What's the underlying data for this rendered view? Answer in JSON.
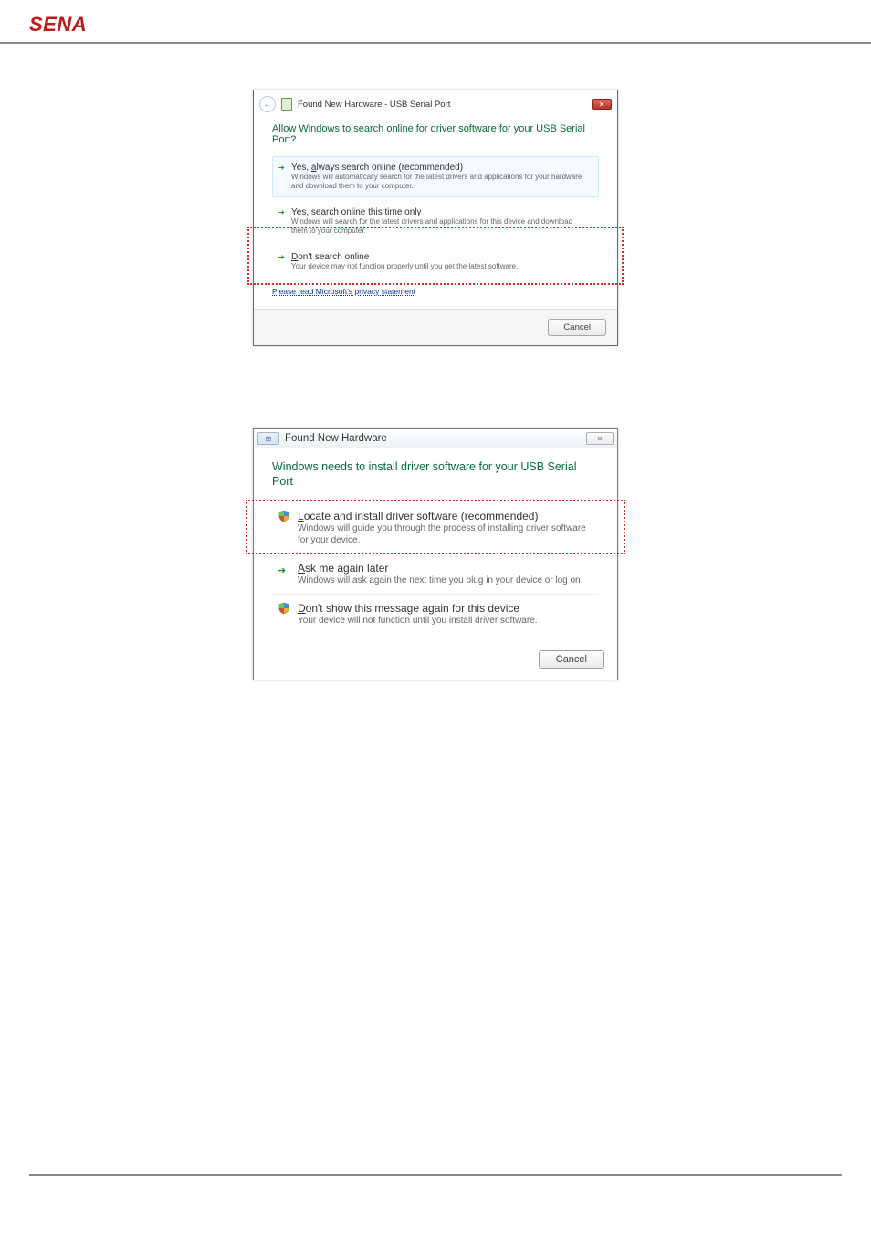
{
  "logo_text": "SENA",
  "dialog1": {
    "window_title": "Found New Hardware - USB Serial Port",
    "heading": "Allow Windows to search online for driver software for your USB Serial Port?",
    "options": [
      {
        "title_pre": "Yes, ",
        "title_ul_char": "a",
        "title_rest": "lways search online (recommended)",
        "desc": "Windows will automatically search for the latest drivers and applications for your hardware and download them to your computer."
      },
      {
        "title_pre": "",
        "title_ul_char": "Y",
        "title_rest": "es, search online this time only",
        "desc": "Windows will search for the latest drivers and applications for this device and download them to your computer."
      },
      {
        "title_pre": "",
        "title_ul_char": "D",
        "title_rest": "on't search online",
        "desc": "Your device may not function properly until you get the latest software."
      }
    ],
    "privacy_link": "Please read Microsoft's privacy statement",
    "cancel_label": "Cancel"
  },
  "dialog2": {
    "window_title": "Found New Hardware",
    "heading": "Windows needs to install driver software for your USB Serial Port",
    "options": [
      {
        "icon": "shield",
        "title_pre": "",
        "title_ul_char": "L",
        "title_rest": "ocate and install driver software (recommended)",
        "desc": "Windows will guide you through the process of installing driver software for your device."
      },
      {
        "icon": "arrow",
        "title_pre": "",
        "title_ul_char": "A",
        "title_rest": "sk me again later",
        "desc": "Windows will ask again the next time you plug in your device or log on."
      },
      {
        "icon": "shield",
        "title_pre": "",
        "title_ul_char": "D",
        "title_rest": "on't show this message again for this device",
        "desc": "Your device will not function until you install driver software."
      }
    ],
    "cancel_label": "Cancel"
  }
}
